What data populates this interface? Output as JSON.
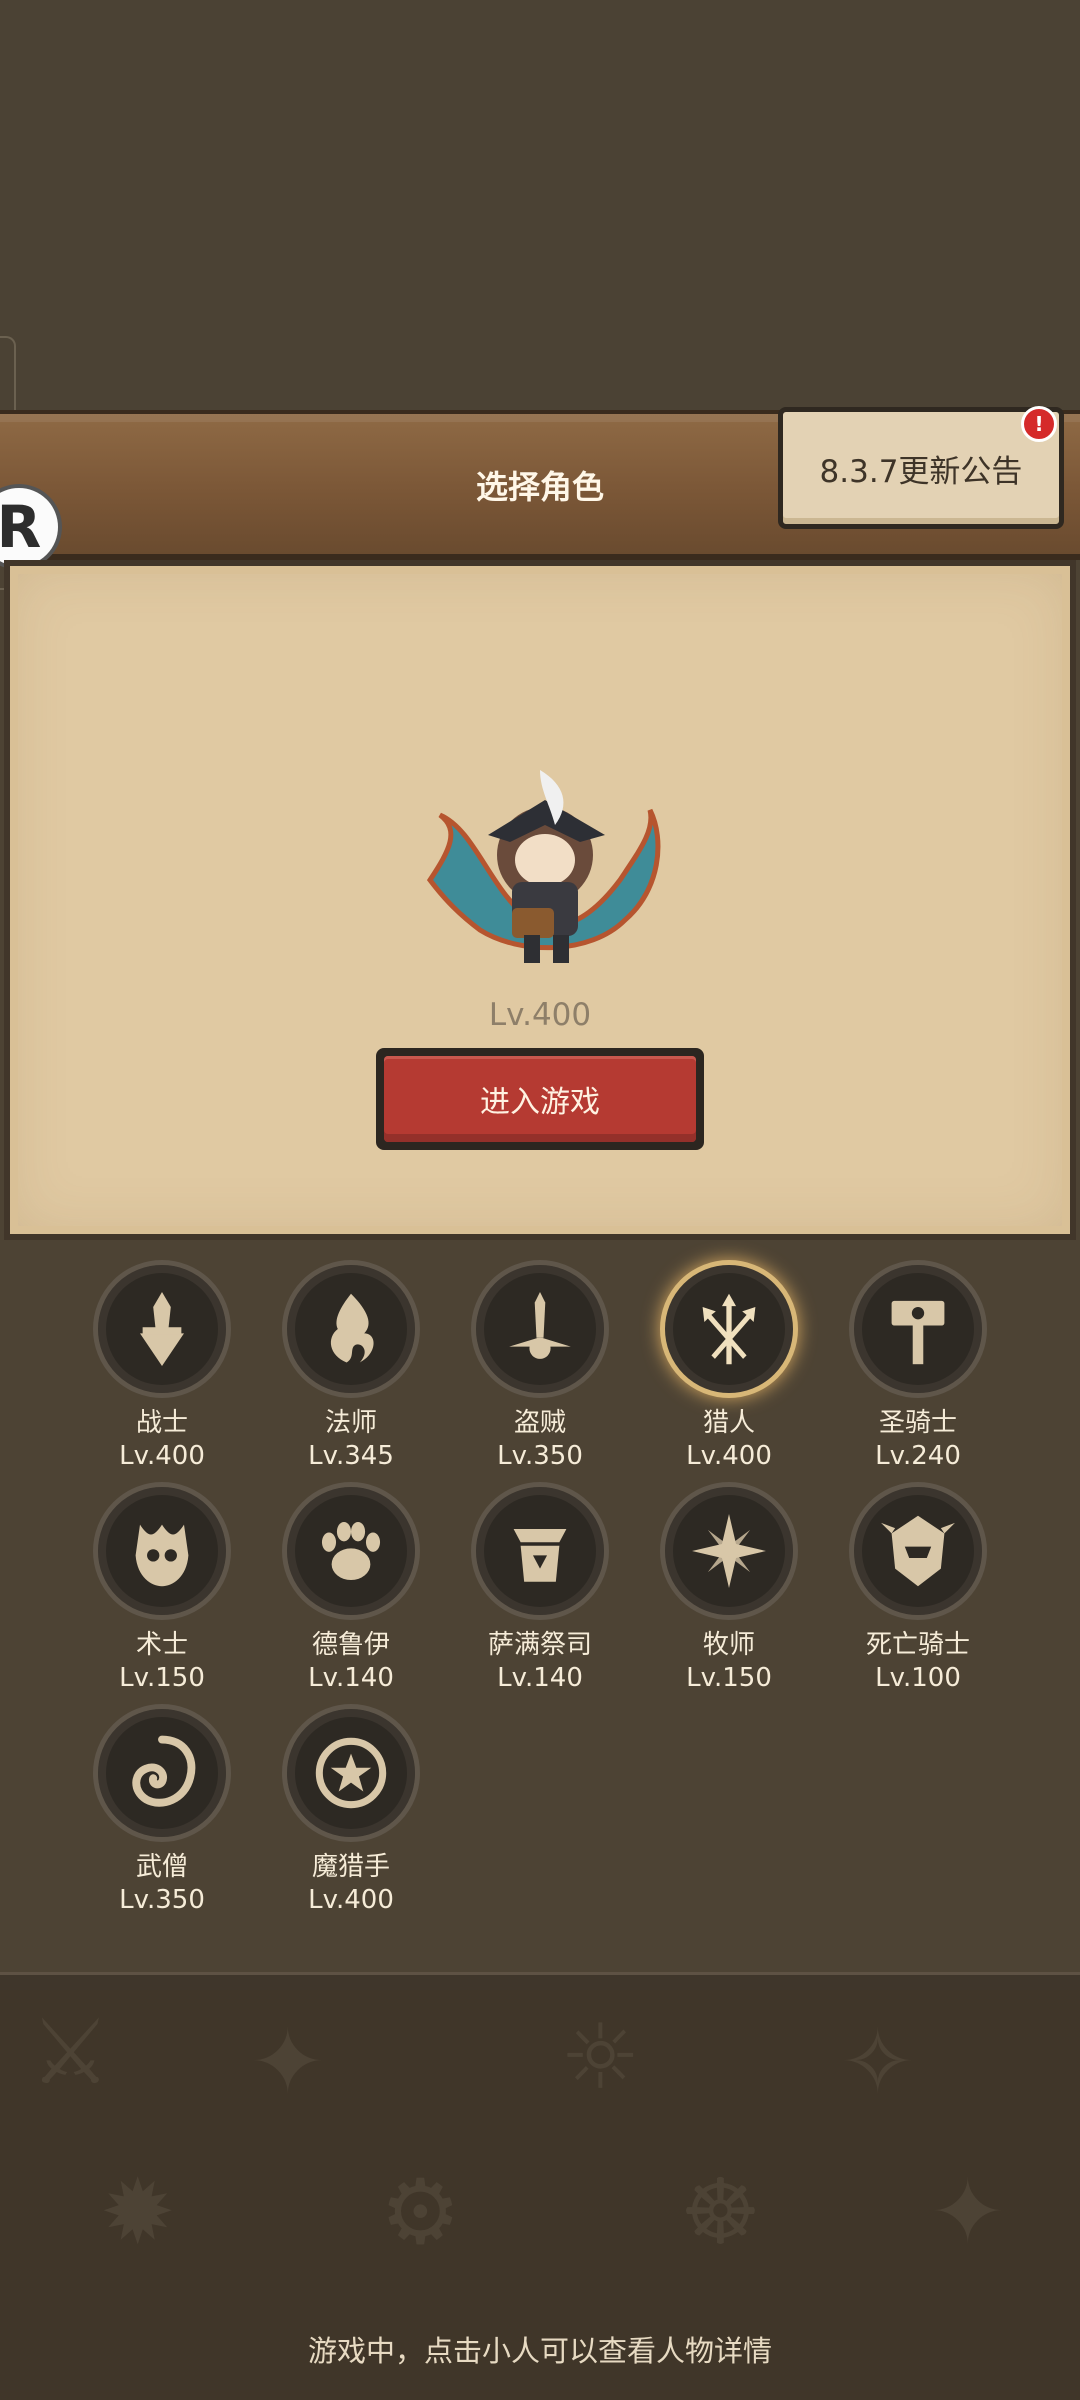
{
  "header": {
    "title": "选择角色"
  },
  "notice": {
    "label": "8.3.7更新公告",
    "badge": "!"
  },
  "logo": {
    "letter": "R"
  },
  "selected_character": {
    "level": "Lv.400",
    "enter_label": "进入游戏"
  },
  "classes": [
    {
      "name": "战士",
      "level": "Lv.400",
      "icon": "sword-icon"
    },
    {
      "name": "法师",
      "level": "Lv.345",
      "icon": "flame-icon"
    },
    {
      "name": "盗贼",
      "level": "Lv.350",
      "icon": "daggers-icon"
    },
    {
      "name": "猎人",
      "level": "Lv.400",
      "icon": "arrows-icon",
      "selected": true
    },
    {
      "name": "圣骑士",
      "level": "Lv.240",
      "icon": "hammer-icon"
    },
    {
      "name": "术士",
      "level": "Lv.150",
      "icon": "skull-icon"
    },
    {
      "name": "德鲁伊",
      "level": "Lv.140",
      "icon": "paw-icon"
    },
    {
      "name": "萨满祭司",
      "level": "Lv.140",
      "icon": "totem-icon"
    },
    {
      "name": "牧师",
      "level": "Lv.150",
      "icon": "star-burst-icon"
    },
    {
      "name": "死亡骑士",
      "level": "Lv.100",
      "icon": "helmet-icon"
    },
    {
      "name": "武僧",
      "level": "Lv.350",
      "icon": "swirl-icon"
    },
    {
      "name": "魔猎手",
      "level": "Lv.400",
      "icon": "demon-star-icon"
    }
  ],
  "footer": {
    "hint": "游戏中，点击小人可以查看人物详情"
  }
}
